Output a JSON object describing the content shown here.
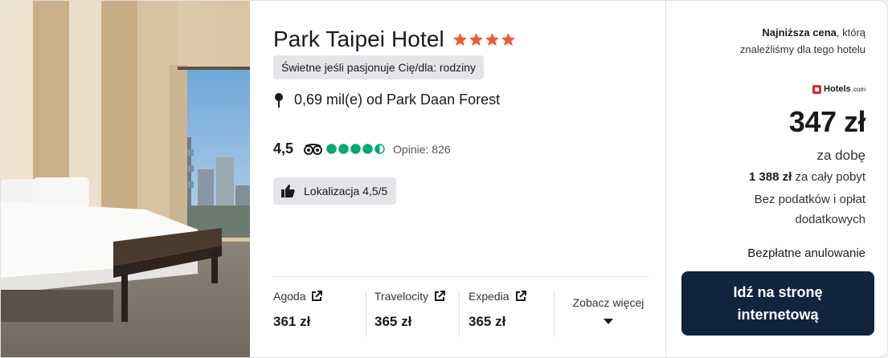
{
  "hotel": {
    "name": "Park Taipei Hotel",
    "star_count": 4,
    "tag": "Świetne jeśli pasjonuje Cię/dla: rodziny",
    "distance": "0,69 mil(e) od Park Daan Forest",
    "rating": "4,5",
    "bubble_rating": 4.5,
    "reviews": "Opinie: 826",
    "location_badge": "Lokalizacja 4,5/5"
  },
  "providers": [
    {
      "name": "Agoda",
      "price": "361 zł"
    },
    {
      "name": "Travelocity",
      "price": "365 zł"
    },
    {
      "name": "Expedia",
      "price": "365 zł"
    }
  ],
  "see_more": "Zobacz więcej",
  "offer": {
    "lowest_bold": "Najniższa cena",
    "lowest_rest_1": ", którą",
    "lowest_rest_2": "znaleźliśmy dla tego hotelu",
    "provider_logo": "Hotels",
    "provider_logo_suffix": ".com",
    "price": "347 zł",
    "per_night": "za dobę",
    "total_bold": "1 388 zł",
    "total_rest": "za cały pobyt",
    "taxes": "Bez podatków i opłat dodatkowych",
    "free_cancel": "Bezpłatne anulowanie",
    "cta": "Idź na stronę internetową"
  },
  "colors": {
    "star": "#f0573b",
    "bubble": "#00aa6c",
    "cta_bg": "#10243d",
    "tag_bg": "#e3e5e8",
    "hotels_brand": "#d32f2f"
  },
  "icons": {
    "pin": "map-pin-icon",
    "owl": "tripadvisor-owl-icon",
    "thumb": "thumbs-up-icon",
    "external": "external-link-icon",
    "caret": "caret-down-icon"
  }
}
